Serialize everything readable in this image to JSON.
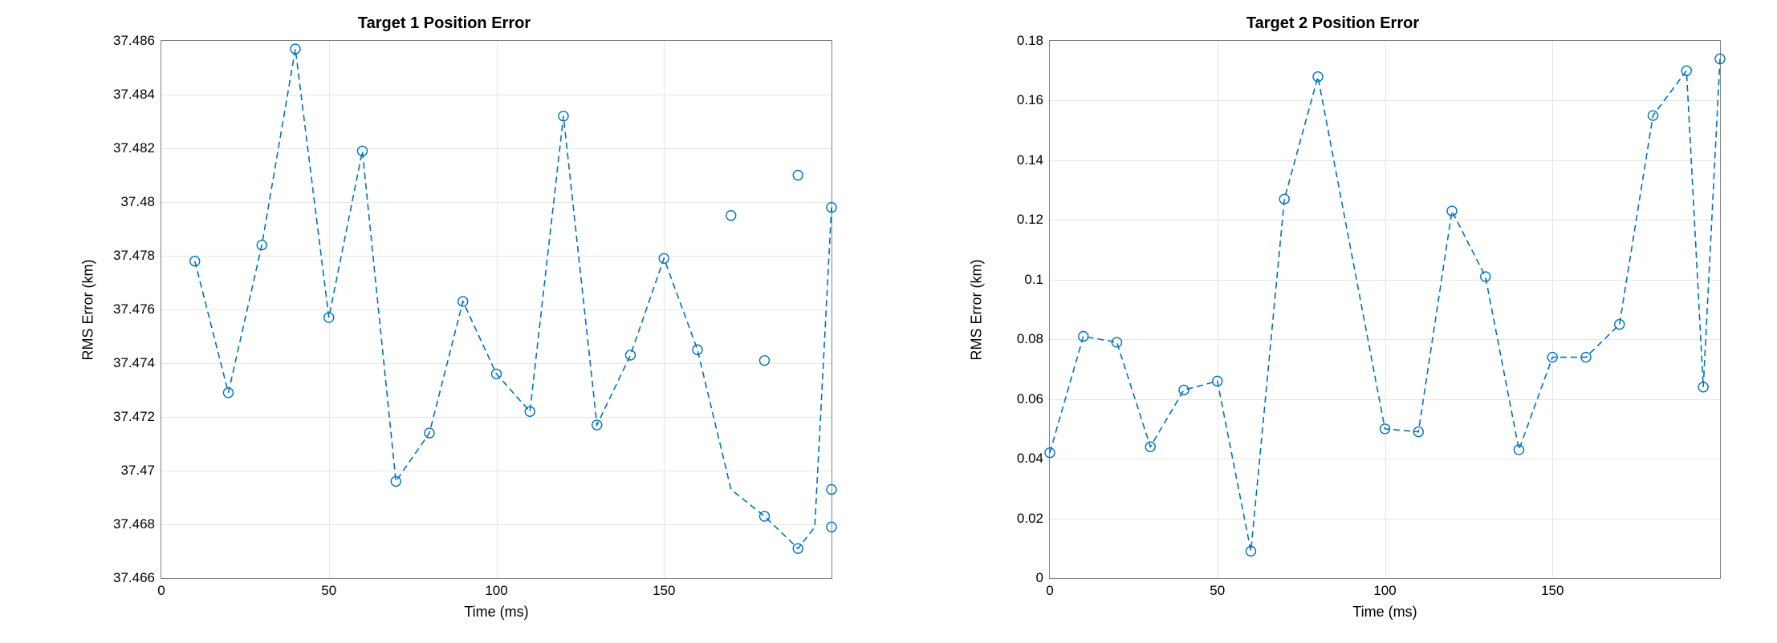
{
  "chart_data": [
    {
      "type": "line",
      "title": "Target 1 Position Error",
      "xlabel": "Time (ms)",
      "ylabel": "RMS Error (km)",
      "xlim": [
        0,
        200
      ],
      "ylim": [
        37.466,
        37.486
      ],
      "xticks": [
        0,
        50,
        100,
        150
      ],
      "yticks": [
        37.466,
        37.468,
        37.47,
        37.472,
        37.474,
        37.476,
        37.478,
        37.48,
        37.482,
        37.484,
        37.486
      ],
      "grid": true,
      "x": [
        10,
        20,
        30,
        40,
        50,
        60,
        70,
        80,
        90,
        100,
        110,
        120,
        130,
        140,
        150,
        160,
        170,
        180,
        190,
        200
      ],
      "y": [
        37.4778,
        37.4729,
        37.4784,
        37.4857,
        37.4757,
        37.4819,
        37.4696,
        37.4714,
        37.4763,
        37.4736,
        37.4722,
        37.4832,
        37.4717,
        37.4743,
        37.4779,
        37.4745,
        37.4795,
        37.4741,
        37.481,
        37.4693
      ],
      "extra_x": [
        180,
        190,
        200
      ],
      "extra_y": [
        37.4683,
        37.4671,
        37.4679
      ],
      "tail_y": 37.4798,
      "marker": "circle",
      "linestyle": "dashed",
      "color": "#0072BD"
    },
    {
      "type": "line",
      "title": "Target 2 Position Error",
      "xlabel": "Time (ms)",
      "ylabel": "RMS Error (km)",
      "xlim": [
        0,
        200
      ],
      "ylim": [
        0,
        0.18
      ],
      "xticks": [
        0,
        50,
        100,
        150
      ],
      "yticks": [
        0,
        0.02,
        0.04,
        0.06,
        0.08,
        0.1,
        0.12,
        0.14,
        0.16,
        0.18
      ],
      "grid": true,
      "x": [
        0,
        10,
        20,
        30,
        40,
        50,
        60,
        70,
        80,
        100,
        110,
        120,
        130,
        140,
        150,
        160,
        170,
        180,
        190,
        200
      ],
      "y": [
        0.042,
        0.081,
        0.079,
        0.044,
        0.063,
        0.066,
        0.009,
        0.127,
        0.168,
        0.05,
        0.049,
        0.123,
        0.101,
        0.043,
        0.074,
        0.074,
        0.085,
        0.155,
        0.17,
        0.064
      ],
      "tail_y": 0.174,
      "marker": "circle",
      "linestyle": "dashed",
      "color": "#0072BD"
    }
  ]
}
